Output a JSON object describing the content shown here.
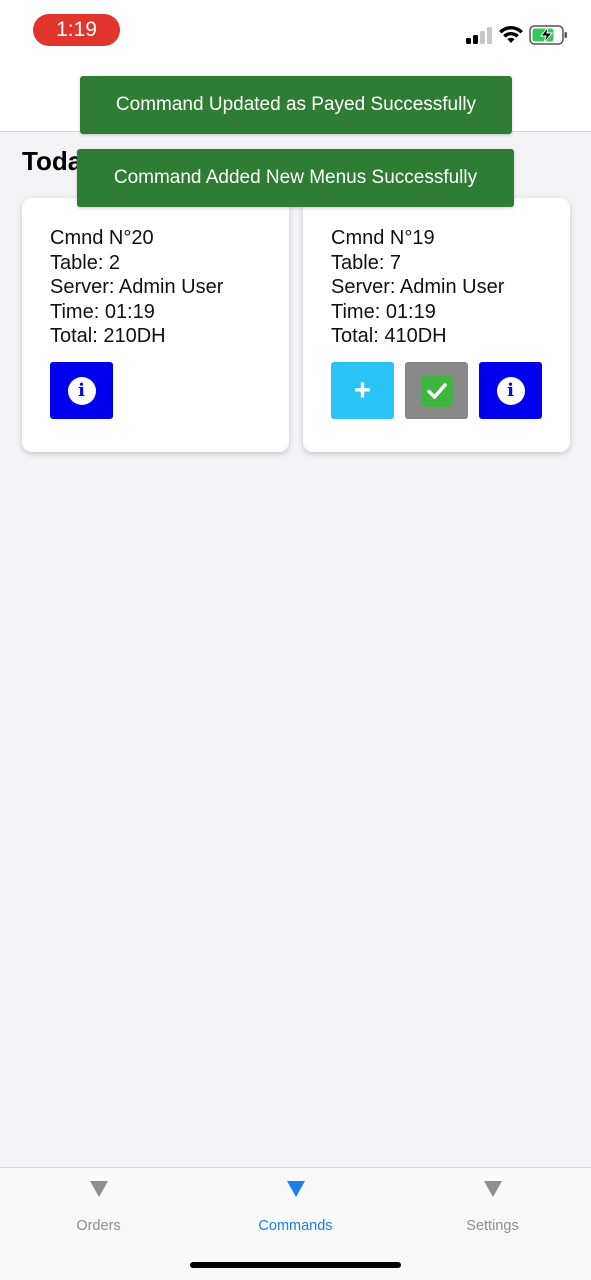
{
  "status_bar": {
    "time": "1:19",
    "signal_icon": "cellular-signal-icon",
    "wifi_icon": "wifi-icon",
    "battery_icon": "battery-charging-icon"
  },
  "section_title": "Toda",
  "toasts": [
    {
      "text": "Command Updated as Payed Successfully"
    },
    {
      "text": "Command Added New Menus Successfully"
    }
  ],
  "commands": [
    {
      "number": "Cmnd N°20",
      "table": "Table: 2",
      "server": "Server: Admin User",
      "time": "Time: 01:19",
      "total": "Total: 210DH",
      "actions": [
        "info-icon"
      ]
    },
    {
      "number": "Cmnd N°19",
      "table": "Table: 7",
      "server": "Server: Admin User",
      "time": "Time: 01:19",
      "total": "Total: 410DH",
      "add_label": "+",
      "actions": [
        "plus-icon",
        "checkmark-icon",
        "info-icon"
      ]
    }
  ],
  "tabs": [
    {
      "label": "Orders",
      "icon": "triangle-down-icon",
      "active": false
    },
    {
      "label": "Commands",
      "icon": "triangle-down-icon",
      "active": true
    },
    {
      "label": "Settings",
      "icon": "triangle-down-icon",
      "active": false
    }
  ],
  "colors": {
    "toast": "#2e7d32",
    "info_button": "#0000ee",
    "add_button": "#29c3f5",
    "pay_button": "#888888",
    "tab_active": "#1a7fe6",
    "tab_inactive": "#8e8e93",
    "time_pill": "#e0342c"
  }
}
